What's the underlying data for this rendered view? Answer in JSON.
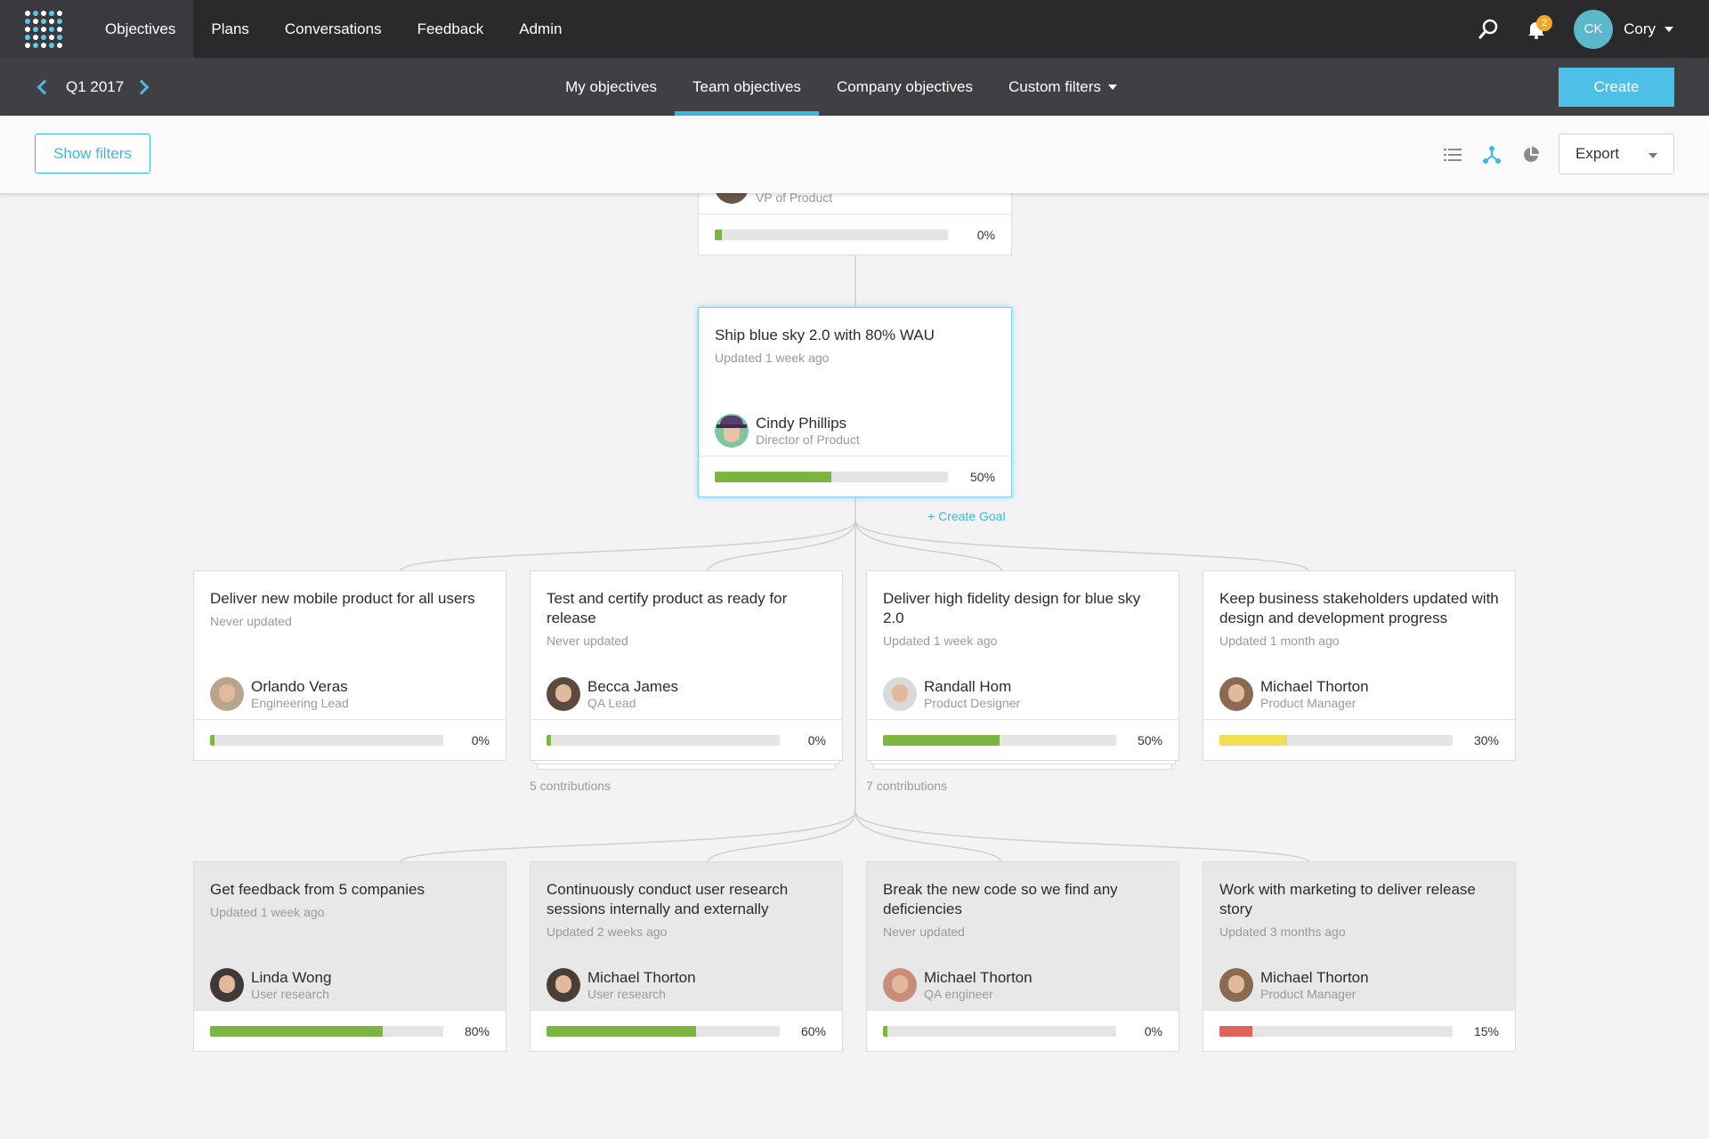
{
  "topnav": {
    "items": [
      "Objectives",
      "Plans",
      "Conversations",
      "Feedback",
      "Admin"
    ],
    "notification_count": "2",
    "user_initials": "CK",
    "user_name": "Cory"
  },
  "subnav": {
    "quarter": "Q1 2017",
    "tabs": [
      "My objectives",
      "Team objectives",
      "Company objectives",
      "Custom filters"
    ],
    "create_label": "Create"
  },
  "toolbar": {
    "show_filters_label": "Show filters",
    "export_label": "Export"
  },
  "colors": {
    "accent": "#3cb8e5",
    "green": "#7db543",
    "yellow": "#f2dd55",
    "red": "#e0625e"
  },
  "parent_card": {
    "role": "VP of Product",
    "progress": 0.03,
    "pct": "0%"
  },
  "focus_card": {
    "title": "Ship blue sky 2.0 with 80% WAU",
    "updated": "Updated 1 week ago",
    "owner": "Cindy Phillips",
    "role": "Director of Product",
    "progress": 0.5,
    "pct": "50%"
  },
  "create_goal_label": "+ Create Goal",
  "children": [
    {
      "title": "Deliver new mobile product for all users",
      "updated": "Never updated",
      "owner": "Orlando Veras",
      "role": "Engineering Lead",
      "progress": 0.02,
      "pct": "0%",
      "color": "#7db543",
      "contributions": ""
    },
    {
      "title": "Test and certify product as ready for release",
      "updated": "Never updated",
      "owner": "Becca James",
      "role": "QA Lead",
      "progress": 0.02,
      "pct": "0%",
      "color": "#7db543",
      "contributions": "5 contributions"
    },
    {
      "title": "Deliver high fidelity design for blue sky 2.0",
      "updated": "Updated 1 week ago",
      "owner": "Randall Hom",
      "role": "Product Designer",
      "progress": 0.5,
      "pct": "50%",
      "color": "#7db543",
      "contributions": "7 contributions"
    },
    {
      "title": "Keep business stakeholders updated with design and development progress",
      "updated": "Updated 1 month ago",
      "owner": "Michael Thorton",
      "role": "Product Manager",
      "progress": 0.29,
      "pct": "30%",
      "color": "#f2dd55",
      "contributions": ""
    }
  ],
  "aligned": [
    {
      "title": "Get feedback from 5 companies",
      "updated": "Updated 1 week ago",
      "owner": "Linda Wong",
      "role": "User research",
      "progress": 0.74,
      "pct": "80%",
      "color": "#7db543"
    },
    {
      "title": "Continuously conduct user research sessions internally and externally",
      "updated": "Updated 2 weeks ago",
      "owner": "Michael Thorton",
      "role": "User research",
      "progress": 0.64,
      "pct": "60%",
      "color": "#7db543"
    },
    {
      "title": "Break the new code so we find any deficiencies",
      "updated": "Never updated",
      "owner": "Michael Thorton",
      "role": "QA engineer",
      "progress": 0.02,
      "pct": "0%",
      "color": "#7db543"
    },
    {
      "title": "Work with marketing to deliver release story",
      "updated": "Updated 3 months ago",
      "owner": "Michael Thorton",
      "role": "Product Manager",
      "progress": 0.14,
      "pct": "15%",
      "color": "#e0625e"
    }
  ]
}
